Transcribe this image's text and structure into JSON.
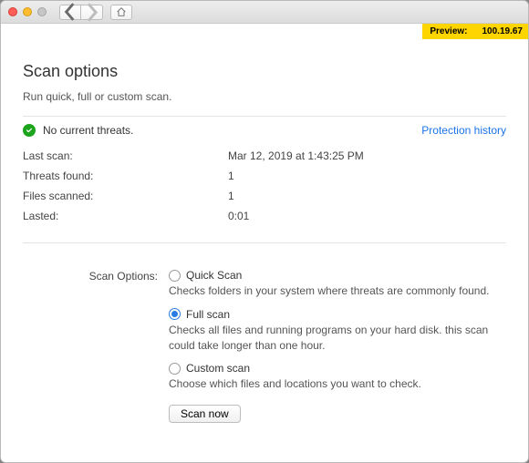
{
  "preview": {
    "label": "Preview:",
    "version": "100.19.67"
  },
  "header": {
    "title": "Scan options",
    "subtitle": "Run quick, full or custom scan."
  },
  "status": {
    "message": "No current threats.",
    "link": "Protection history"
  },
  "details": [
    {
      "k": "Last scan:",
      "v": "Mar 12, 2019 at 1:43:25 PM"
    },
    {
      "k": "Threats found:",
      "v": "1"
    },
    {
      "k": "Files scanned:",
      "v": "1"
    },
    {
      "k": "Lasted:",
      "v": "0:01"
    }
  ],
  "scan": {
    "group_label": "Scan Options:",
    "options": [
      {
        "label": "Quick Scan",
        "desc": "Checks folders in your system where threats are commonly found.",
        "selected": false
      },
      {
        "label": "Full scan",
        "desc": "Checks all files and running programs on your hard disk. this scan could take longer than one hour.",
        "selected": true
      },
      {
        "label": "Custom scan",
        "desc": "Choose which files and locations you want to check.",
        "selected": false
      }
    ],
    "button": "Scan now"
  }
}
